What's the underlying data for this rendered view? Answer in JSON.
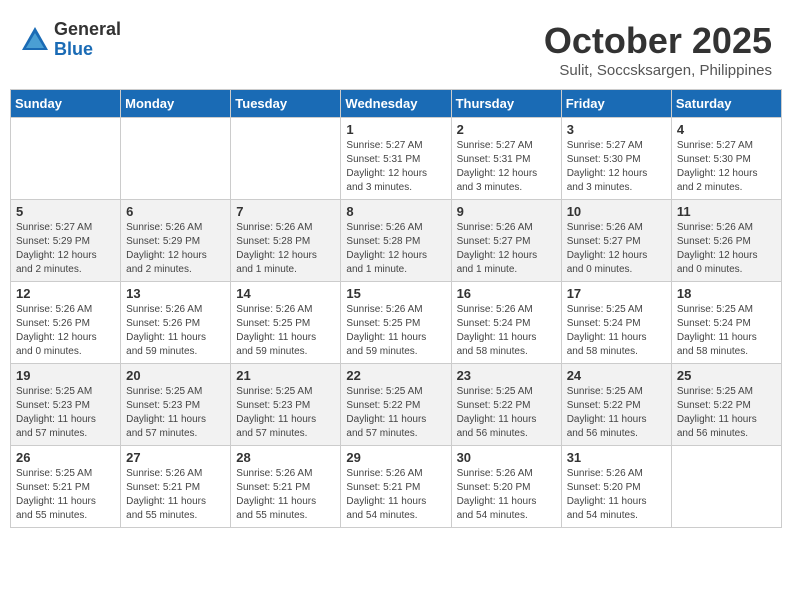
{
  "logo": {
    "general": "General",
    "blue": "Blue"
  },
  "title": "October 2025",
  "subtitle": "Sulit, Soccsksargen, Philippines",
  "weekdays": [
    "Sunday",
    "Monday",
    "Tuesday",
    "Wednesday",
    "Thursday",
    "Friday",
    "Saturday"
  ],
  "weeks": [
    [
      {
        "day": "",
        "info": ""
      },
      {
        "day": "",
        "info": ""
      },
      {
        "day": "",
        "info": ""
      },
      {
        "day": "1",
        "info": "Sunrise: 5:27 AM\nSunset: 5:31 PM\nDaylight: 12 hours\nand 3 minutes."
      },
      {
        "day": "2",
        "info": "Sunrise: 5:27 AM\nSunset: 5:31 PM\nDaylight: 12 hours\nand 3 minutes."
      },
      {
        "day": "3",
        "info": "Sunrise: 5:27 AM\nSunset: 5:30 PM\nDaylight: 12 hours\nand 3 minutes."
      },
      {
        "day": "4",
        "info": "Sunrise: 5:27 AM\nSunset: 5:30 PM\nDaylight: 12 hours\nand 2 minutes."
      }
    ],
    [
      {
        "day": "5",
        "info": "Sunrise: 5:27 AM\nSunset: 5:29 PM\nDaylight: 12 hours\nand 2 minutes."
      },
      {
        "day": "6",
        "info": "Sunrise: 5:26 AM\nSunset: 5:29 PM\nDaylight: 12 hours\nand 2 minutes."
      },
      {
        "day": "7",
        "info": "Sunrise: 5:26 AM\nSunset: 5:28 PM\nDaylight: 12 hours\nand 1 minute."
      },
      {
        "day": "8",
        "info": "Sunrise: 5:26 AM\nSunset: 5:28 PM\nDaylight: 12 hours\nand 1 minute."
      },
      {
        "day": "9",
        "info": "Sunrise: 5:26 AM\nSunset: 5:27 PM\nDaylight: 12 hours\nand 1 minute."
      },
      {
        "day": "10",
        "info": "Sunrise: 5:26 AM\nSunset: 5:27 PM\nDaylight: 12 hours\nand 0 minutes."
      },
      {
        "day": "11",
        "info": "Sunrise: 5:26 AM\nSunset: 5:26 PM\nDaylight: 12 hours\nand 0 minutes."
      }
    ],
    [
      {
        "day": "12",
        "info": "Sunrise: 5:26 AM\nSunset: 5:26 PM\nDaylight: 12 hours\nand 0 minutes."
      },
      {
        "day": "13",
        "info": "Sunrise: 5:26 AM\nSunset: 5:26 PM\nDaylight: 11 hours\nand 59 minutes."
      },
      {
        "day": "14",
        "info": "Sunrise: 5:26 AM\nSunset: 5:25 PM\nDaylight: 11 hours\nand 59 minutes."
      },
      {
        "day": "15",
        "info": "Sunrise: 5:26 AM\nSunset: 5:25 PM\nDaylight: 11 hours\nand 59 minutes."
      },
      {
        "day": "16",
        "info": "Sunrise: 5:26 AM\nSunset: 5:24 PM\nDaylight: 11 hours\nand 58 minutes."
      },
      {
        "day": "17",
        "info": "Sunrise: 5:25 AM\nSunset: 5:24 PM\nDaylight: 11 hours\nand 58 minutes."
      },
      {
        "day": "18",
        "info": "Sunrise: 5:25 AM\nSunset: 5:24 PM\nDaylight: 11 hours\nand 58 minutes."
      }
    ],
    [
      {
        "day": "19",
        "info": "Sunrise: 5:25 AM\nSunset: 5:23 PM\nDaylight: 11 hours\nand 57 minutes."
      },
      {
        "day": "20",
        "info": "Sunrise: 5:25 AM\nSunset: 5:23 PM\nDaylight: 11 hours\nand 57 minutes."
      },
      {
        "day": "21",
        "info": "Sunrise: 5:25 AM\nSunset: 5:23 PM\nDaylight: 11 hours\nand 57 minutes."
      },
      {
        "day": "22",
        "info": "Sunrise: 5:25 AM\nSunset: 5:22 PM\nDaylight: 11 hours\nand 57 minutes."
      },
      {
        "day": "23",
        "info": "Sunrise: 5:25 AM\nSunset: 5:22 PM\nDaylight: 11 hours\nand 56 minutes."
      },
      {
        "day": "24",
        "info": "Sunrise: 5:25 AM\nSunset: 5:22 PM\nDaylight: 11 hours\nand 56 minutes."
      },
      {
        "day": "25",
        "info": "Sunrise: 5:25 AM\nSunset: 5:22 PM\nDaylight: 11 hours\nand 56 minutes."
      }
    ],
    [
      {
        "day": "26",
        "info": "Sunrise: 5:25 AM\nSunset: 5:21 PM\nDaylight: 11 hours\nand 55 minutes."
      },
      {
        "day": "27",
        "info": "Sunrise: 5:26 AM\nSunset: 5:21 PM\nDaylight: 11 hours\nand 55 minutes."
      },
      {
        "day": "28",
        "info": "Sunrise: 5:26 AM\nSunset: 5:21 PM\nDaylight: 11 hours\nand 55 minutes."
      },
      {
        "day": "29",
        "info": "Sunrise: 5:26 AM\nSunset: 5:21 PM\nDaylight: 11 hours\nand 54 minutes."
      },
      {
        "day": "30",
        "info": "Sunrise: 5:26 AM\nSunset: 5:20 PM\nDaylight: 11 hours\nand 54 minutes."
      },
      {
        "day": "31",
        "info": "Sunrise: 5:26 AM\nSunset: 5:20 PM\nDaylight: 11 hours\nand 54 minutes."
      },
      {
        "day": "",
        "info": ""
      }
    ]
  ]
}
